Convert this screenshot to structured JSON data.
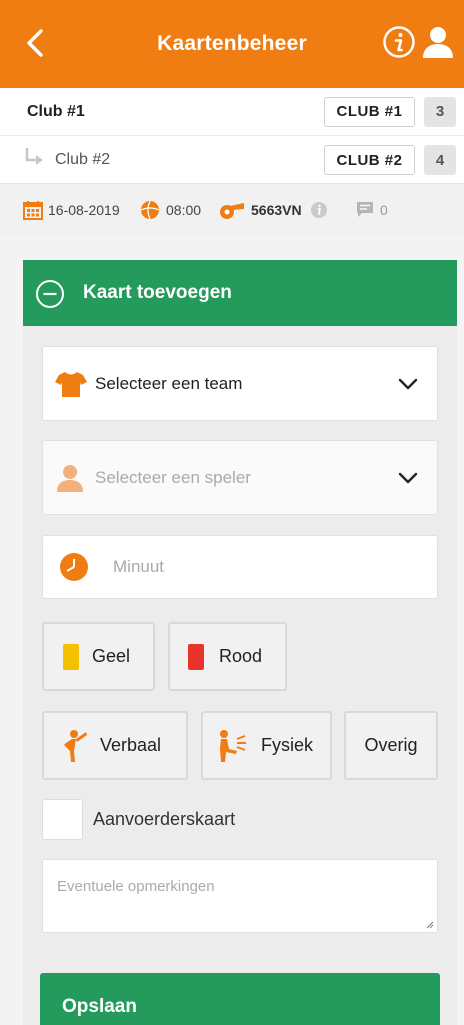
{
  "header": {
    "title": "Kaartenbeheer",
    "bg_color": "#ef7d12"
  },
  "clubs": [
    {
      "name": "Club #1",
      "badge": "CLUB #1",
      "number": "3"
    },
    {
      "name": "Club #2",
      "badge": "CLUB #2",
      "number": "4"
    }
  ],
  "match": {
    "date": "16-08-2019",
    "time": "08:00",
    "code": "5663VN",
    "comments_count": "0"
  },
  "form": {
    "header_title": "Kaart toevoegen",
    "team_select": {
      "value": "Selecteer een team"
    },
    "player_select": {
      "placeholder": "Selecteer een speler"
    },
    "minute_input": {
      "placeholder": "Minuut"
    },
    "card_colors": [
      {
        "label": "Geel",
        "color": "#f5c000"
      },
      {
        "label": "Rood",
        "color": "#e8332a"
      }
    ],
    "card_types": [
      {
        "label": "Verbaal",
        "icon": "verbal-icon"
      },
      {
        "label": "Fysiek",
        "icon": "physical-icon"
      },
      {
        "label": "Overig",
        "icon": ""
      }
    ],
    "captain_card_label": "Aanvoerderskaart",
    "remarks_placeholder": "Eventuele opmerkingen",
    "save_label": "Opslaan"
  },
  "colors": {
    "accent_orange": "#ef7d12",
    "accent_green": "#249b5c"
  }
}
